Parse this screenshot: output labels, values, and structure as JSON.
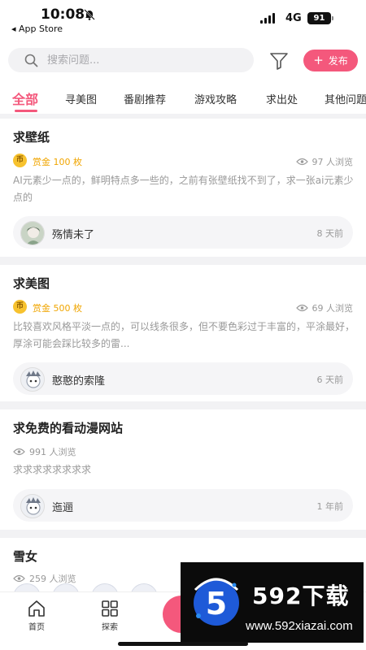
{
  "status_bar": {
    "time": "10:08",
    "back_app": "◂ App Store",
    "network": "4G",
    "battery": "91"
  },
  "search": {
    "placeholder": "搜索问题...",
    "publish_label": "发布",
    "publish_icon": "+"
  },
  "tabs": [
    {
      "label": "全部",
      "active": true
    },
    {
      "label": "寻美图"
    },
    {
      "label": "番剧推荐"
    },
    {
      "label": "游戏攻略"
    },
    {
      "label": "求出处"
    },
    {
      "label": "其他问题"
    }
  ],
  "posts": [
    {
      "title": "求壁纸",
      "coin": "币",
      "reward": "赏金 100 枚",
      "views": "97 人浏览",
      "desc": "AI元素少一点的，鲜明特点多一些的，之前有张壁纸找不到了，求一张ai元素少点的",
      "user": "殇情未了",
      "time": "8 天前"
    },
    {
      "title": "求美图",
      "coin": "币",
      "reward": "赏金 500 枚",
      "views": "69 人浏览",
      "desc": "比较喜欢风格平淡一点的，可以线条很多，但不要色彩过于丰富的，平涂最好，厚涂可能会踩比较多的雷...",
      "user": "憨憨的索隆",
      "time": "6 天前"
    },
    {
      "title": "求免费的看动漫网站",
      "views": "991 人浏览",
      "desc": "求求求求求求求求",
      "user": "迤逦",
      "time": "1 年前"
    },
    {
      "title": "雪女",
      "views": "259 人浏览"
    }
  ],
  "bottom_nav": {
    "home_label": "首页",
    "explore_label": "探索"
  },
  "watermark": {
    "name": "592下载",
    "url": "www.592xiazai.com"
  },
  "colors": {
    "accent": "#f4587c",
    "reward": "#f0a500",
    "coin": "#f7c22e"
  }
}
